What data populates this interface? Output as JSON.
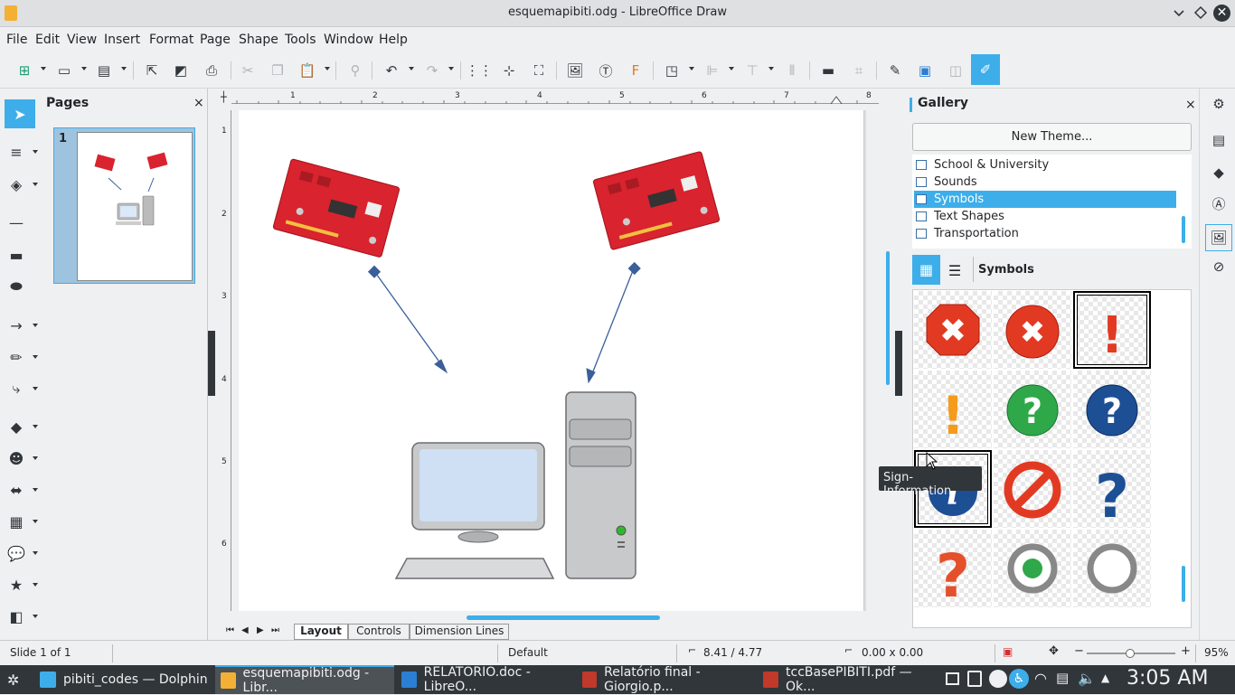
{
  "window": {
    "title": "esquemapibiti.odg - LibreOffice Draw"
  },
  "menu": [
    "File",
    "Edit",
    "View",
    "Insert",
    "Format",
    "Page",
    "Shape",
    "Tools",
    "Window",
    "Help"
  ],
  "pages_panel": {
    "title": "Pages",
    "close": "×",
    "page_number": "1"
  },
  "ruler": {
    "h_labels": [
      "1",
      "2",
      "3",
      "4",
      "5",
      "6",
      "7",
      "8"
    ],
    "v_labels": [
      "1",
      "2",
      "3",
      "4",
      "5",
      "6"
    ]
  },
  "canvas_tabs": [
    "Layout",
    "Controls",
    "Dimension Lines"
  ],
  "gallery": {
    "title": "Gallery",
    "close": "×",
    "new_theme_label": "New Theme...",
    "themes": [
      "School & University",
      "Sounds",
      "Symbols",
      "Text Shapes",
      "Transportation"
    ],
    "selected_theme": "Symbols",
    "view_title": "Symbols",
    "tooltip": "Sign-Information"
  },
  "status": {
    "slide": "Slide 1 of 1",
    "layout": "Default",
    "position": "8.41 / 4.77",
    "size": "0.00 x 0.00",
    "zoom_minus": "−",
    "zoom_plus": "+",
    "zoom": "95%"
  },
  "taskbar": {
    "tasks": [
      {
        "label": "pibiti_codes — Dolphin",
        "color": "#3daee9"
      },
      {
        "label": "esquemapibiti.odg - Libr...",
        "color": "#f2b134"
      },
      {
        "label": "RELATORIO.doc - LibreO...",
        "color": "#2a7fd4"
      },
      {
        "label": "Relatório final - Giorgio.p...",
        "color": "#c0392b"
      },
      {
        "label": "tccBasePIBITI.pdf — Ok...",
        "color": "#c0392b"
      }
    ],
    "clock": "3:05 AM"
  },
  "colors": {
    "accent": "#3daee9",
    "pcb_red": "#d9232e",
    "arrow": "#3a5f9a"
  }
}
